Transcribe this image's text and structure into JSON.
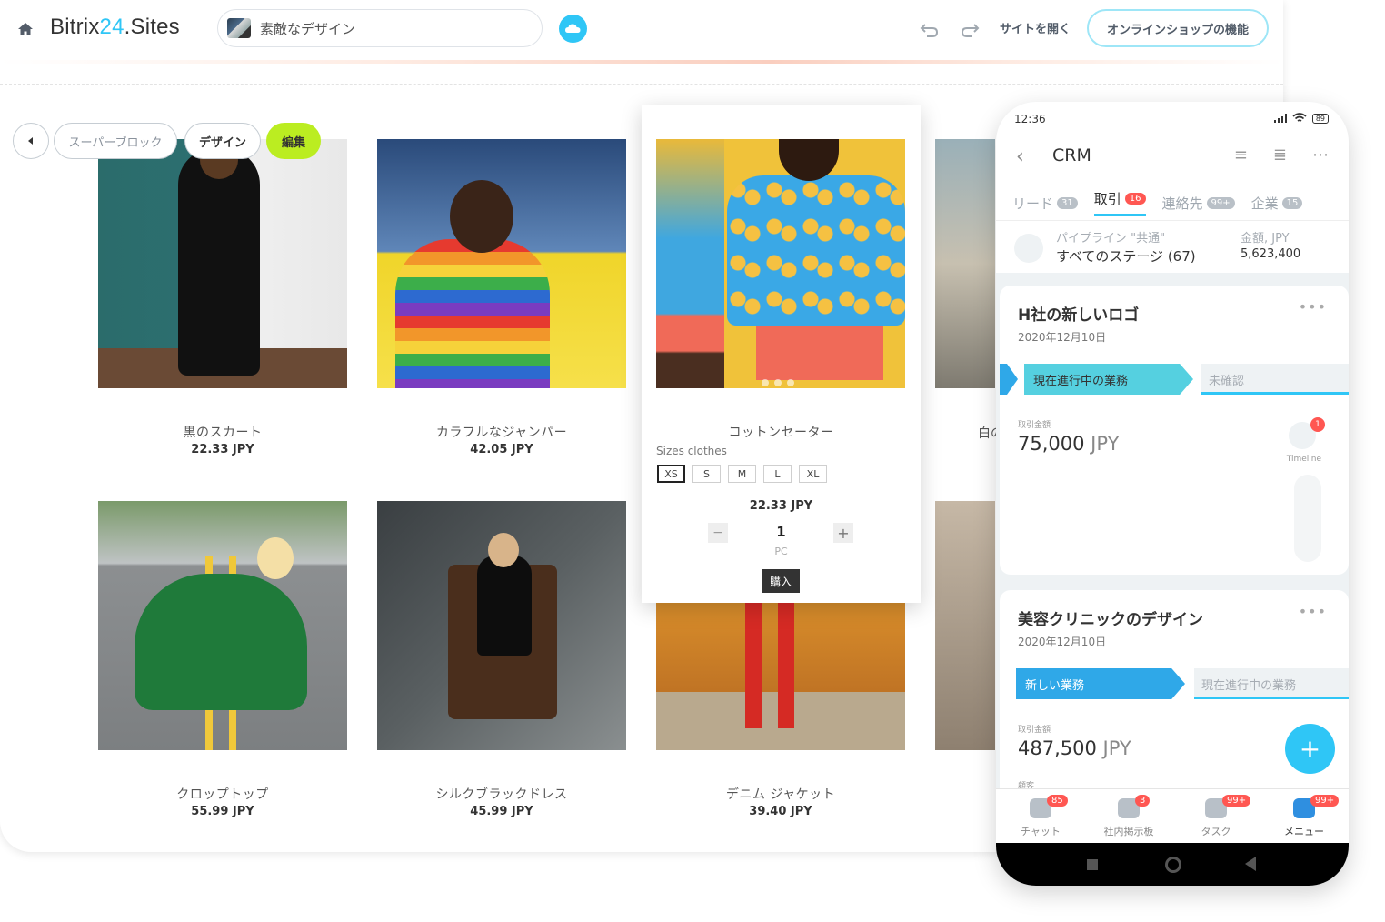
{
  "topbar": {
    "brand_prefix": "Bitrix",
    "brand_accent": "24",
    "brand_suffix": ".Sites",
    "site_name": "素敵なデザイン",
    "open_site": "サイトを開く",
    "shop_features": "オンラインショップの機能"
  },
  "block_toolbar": {
    "super_block": "スーパーブロック",
    "design": "デザイン",
    "edit": "編集"
  },
  "products": [
    {
      "title": "黒のスカート",
      "price": "22.33 JPY"
    },
    {
      "title": "カラフルなジャンパー",
      "price": "42.05 JPY"
    },
    {
      "title": "コットンセーター",
      "price": "22.33 JPY"
    },
    {
      "title": "クロップトップ",
      "price": "55.99 JPY"
    },
    {
      "title": "シルクブラックドレス",
      "price": "45.99 JPY"
    },
    {
      "title": "デニム ジャケット",
      "price": "39.40 JPY"
    }
  ],
  "clipped_title": "白の",
  "popup": {
    "sizes_label": "Sizes clothes",
    "sizes": [
      "XS",
      "S",
      "M",
      "L",
      "XL"
    ],
    "selected_size": "XS",
    "price": "22.33 JPY",
    "qty": "1",
    "unit": "PC",
    "buy": "購入",
    "minus": "−",
    "plus": "+"
  },
  "phone": {
    "time": "12:36",
    "battery": "89",
    "title": "CRM",
    "tabs": [
      {
        "label": "リード",
        "count": "31"
      },
      {
        "label": "取引",
        "count": "16"
      },
      {
        "label": "連絡先",
        "count": "99+"
      },
      {
        "label": "企業",
        "count": "15"
      }
    ],
    "pipeline_label": "パイプライン \"共通\"",
    "pipeline_stage": "すべてのステージ (67)",
    "sum_label": "金額, JPY",
    "sum_value": "5,623,400",
    "deals": [
      {
        "title": "H社の新しいロゴ",
        "date": "2020年12月10日",
        "stage_current": "現在進行中の業務",
        "stage_next": "未確認",
        "amount_label": "取引金額",
        "amount": "75,000",
        "currency": "JPY",
        "timeline_label": "Timeline",
        "timeline_badge": "1"
      },
      {
        "title": "美容クリニックのデザイン",
        "date": "2020年12月10日",
        "stage_current": "新しい業務",
        "stage_next": "現在進行中の業務",
        "amount_label": "取引金額",
        "amount": "487,500",
        "currency": "JPY",
        "client_label": "顧客"
      }
    ],
    "fab": "+",
    "bottom_nav": [
      {
        "label": "チャット",
        "badge": "85"
      },
      {
        "label": "社内掲示板",
        "badge": "3"
      },
      {
        "label": "タスク",
        "badge": "99+"
      },
      {
        "label": "メニュー",
        "badge": "99+"
      }
    ]
  },
  "colors": {
    "accent": "#2fc6f6",
    "edit_green": "#bbed21",
    "badge_red": "#ff5752"
  }
}
